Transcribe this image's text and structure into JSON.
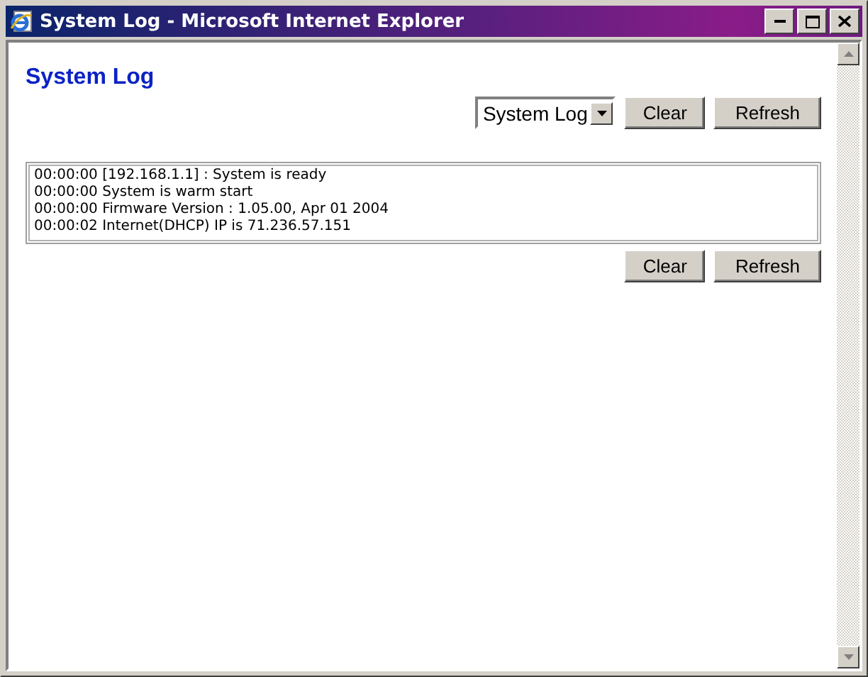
{
  "window": {
    "title": "System Log - Microsoft Internet Explorer"
  },
  "page": {
    "heading": "System Log",
    "log_select": {
      "value": "System Log"
    },
    "top_buttons": [
      "Clear",
      "Refresh"
    ],
    "log_lines": [
      "00:00:00 [192.168.1.1] : System is ready",
      "00:00:00 System is warm start",
      "00:00:00 Firmware Version : 1.05.00, Apr 01 2004",
      "00:00:02 Internet(DHCP) IP is 71.236.57.151"
    ],
    "bottom_buttons": [
      "Clear",
      "Refresh"
    ]
  }
}
